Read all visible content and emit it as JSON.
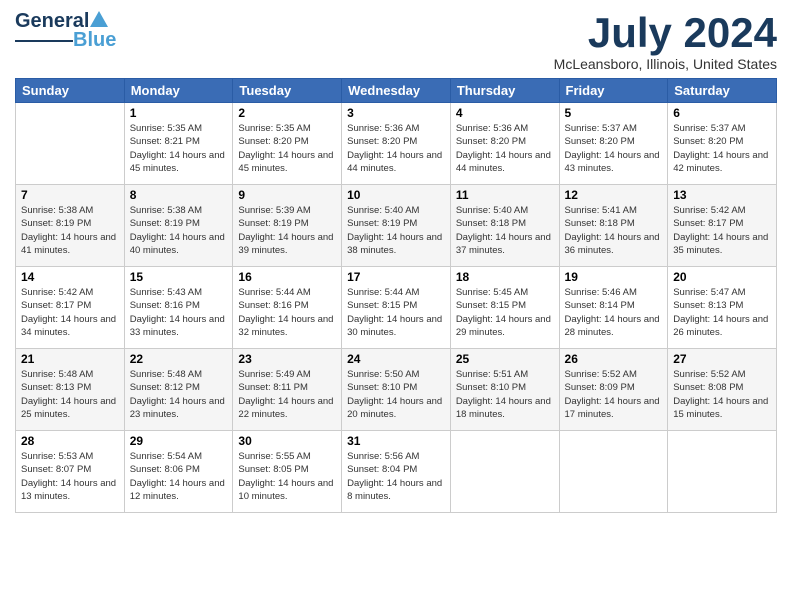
{
  "header": {
    "logo_general": "General",
    "logo_blue": "Blue",
    "month_title": "July 2024",
    "location": "McLeansboro, Illinois, United States"
  },
  "weekdays": [
    "Sunday",
    "Monday",
    "Tuesday",
    "Wednesday",
    "Thursday",
    "Friday",
    "Saturday"
  ],
  "weeks": [
    [
      {
        "day": "",
        "sunrise": "",
        "sunset": "",
        "daylight": ""
      },
      {
        "day": "1",
        "sunrise": "Sunrise: 5:35 AM",
        "sunset": "Sunset: 8:21 PM",
        "daylight": "Daylight: 14 hours and 45 minutes."
      },
      {
        "day": "2",
        "sunrise": "Sunrise: 5:35 AM",
        "sunset": "Sunset: 8:20 PM",
        "daylight": "Daylight: 14 hours and 45 minutes."
      },
      {
        "day": "3",
        "sunrise": "Sunrise: 5:36 AM",
        "sunset": "Sunset: 8:20 PM",
        "daylight": "Daylight: 14 hours and 44 minutes."
      },
      {
        "day": "4",
        "sunrise": "Sunrise: 5:36 AM",
        "sunset": "Sunset: 8:20 PM",
        "daylight": "Daylight: 14 hours and 44 minutes."
      },
      {
        "day": "5",
        "sunrise": "Sunrise: 5:37 AM",
        "sunset": "Sunset: 8:20 PM",
        "daylight": "Daylight: 14 hours and 43 minutes."
      },
      {
        "day": "6",
        "sunrise": "Sunrise: 5:37 AM",
        "sunset": "Sunset: 8:20 PM",
        "daylight": "Daylight: 14 hours and 42 minutes."
      }
    ],
    [
      {
        "day": "7",
        "sunrise": "Sunrise: 5:38 AM",
        "sunset": "Sunset: 8:19 PM",
        "daylight": "Daylight: 14 hours and 41 minutes."
      },
      {
        "day": "8",
        "sunrise": "Sunrise: 5:38 AM",
        "sunset": "Sunset: 8:19 PM",
        "daylight": "Daylight: 14 hours and 40 minutes."
      },
      {
        "day": "9",
        "sunrise": "Sunrise: 5:39 AM",
        "sunset": "Sunset: 8:19 PM",
        "daylight": "Daylight: 14 hours and 39 minutes."
      },
      {
        "day": "10",
        "sunrise": "Sunrise: 5:40 AM",
        "sunset": "Sunset: 8:19 PM",
        "daylight": "Daylight: 14 hours and 38 minutes."
      },
      {
        "day": "11",
        "sunrise": "Sunrise: 5:40 AM",
        "sunset": "Sunset: 8:18 PM",
        "daylight": "Daylight: 14 hours and 37 minutes."
      },
      {
        "day": "12",
        "sunrise": "Sunrise: 5:41 AM",
        "sunset": "Sunset: 8:18 PM",
        "daylight": "Daylight: 14 hours and 36 minutes."
      },
      {
        "day": "13",
        "sunrise": "Sunrise: 5:42 AM",
        "sunset": "Sunset: 8:17 PM",
        "daylight": "Daylight: 14 hours and 35 minutes."
      }
    ],
    [
      {
        "day": "14",
        "sunrise": "Sunrise: 5:42 AM",
        "sunset": "Sunset: 8:17 PM",
        "daylight": "Daylight: 14 hours and 34 minutes."
      },
      {
        "day": "15",
        "sunrise": "Sunrise: 5:43 AM",
        "sunset": "Sunset: 8:16 PM",
        "daylight": "Daylight: 14 hours and 33 minutes."
      },
      {
        "day": "16",
        "sunrise": "Sunrise: 5:44 AM",
        "sunset": "Sunset: 8:16 PM",
        "daylight": "Daylight: 14 hours and 32 minutes."
      },
      {
        "day": "17",
        "sunrise": "Sunrise: 5:44 AM",
        "sunset": "Sunset: 8:15 PM",
        "daylight": "Daylight: 14 hours and 30 minutes."
      },
      {
        "day": "18",
        "sunrise": "Sunrise: 5:45 AM",
        "sunset": "Sunset: 8:15 PM",
        "daylight": "Daylight: 14 hours and 29 minutes."
      },
      {
        "day": "19",
        "sunrise": "Sunrise: 5:46 AM",
        "sunset": "Sunset: 8:14 PM",
        "daylight": "Daylight: 14 hours and 28 minutes."
      },
      {
        "day": "20",
        "sunrise": "Sunrise: 5:47 AM",
        "sunset": "Sunset: 8:13 PM",
        "daylight": "Daylight: 14 hours and 26 minutes."
      }
    ],
    [
      {
        "day": "21",
        "sunrise": "Sunrise: 5:48 AM",
        "sunset": "Sunset: 8:13 PM",
        "daylight": "Daylight: 14 hours and 25 minutes."
      },
      {
        "day": "22",
        "sunrise": "Sunrise: 5:48 AM",
        "sunset": "Sunset: 8:12 PM",
        "daylight": "Daylight: 14 hours and 23 minutes."
      },
      {
        "day": "23",
        "sunrise": "Sunrise: 5:49 AM",
        "sunset": "Sunset: 8:11 PM",
        "daylight": "Daylight: 14 hours and 22 minutes."
      },
      {
        "day": "24",
        "sunrise": "Sunrise: 5:50 AM",
        "sunset": "Sunset: 8:10 PM",
        "daylight": "Daylight: 14 hours and 20 minutes."
      },
      {
        "day": "25",
        "sunrise": "Sunrise: 5:51 AM",
        "sunset": "Sunset: 8:10 PM",
        "daylight": "Daylight: 14 hours and 18 minutes."
      },
      {
        "day": "26",
        "sunrise": "Sunrise: 5:52 AM",
        "sunset": "Sunset: 8:09 PM",
        "daylight": "Daylight: 14 hours and 17 minutes."
      },
      {
        "day": "27",
        "sunrise": "Sunrise: 5:52 AM",
        "sunset": "Sunset: 8:08 PM",
        "daylight": "Daylight: 14 hours and 15 minutes."
      }
    ],
    [
      {
        "day": "28",
        "sunrise": "Sunrise: 5:53 AM",
        "sunset": "Sunset: 8:07 PM",
        "daylight": "Daylight: 14 hours and 13 minutes."
      },
      {
        "day": "29",
        "sunrise": "Sunrise: 5:54 AM",
        "sunset": "Sunset: 8:06 PM",
        "daylight": "Daylight: 14 hours and 12 minutes."
      },
      {
        "day": "30",
        "sunrise": "Sunrise: 5:55 AM",
        "sunset": "Sunset: 8:05 PM",
        "daylight": "Daylight: 14 hours and 10 minutes."
      },
      {
        "day": "31",
        "sunrise": "Sunrise: 5:56 AM",
        "sunset": "Sunset: 8:04 PM",
        "daylight": "Daylight: 14 hours and 8 minutes."
      },
      {
        "day": "",
        "sunrise": "",
        "sunset": "",
        "daylight": ""
      },
      {
        "day": "",
        "sunrise": "",
        "sunset": "",
        "daylight": ""
      },
      {
        "day": "",
        "sunrise": "",
        "sunset": "",
        "daylight": ""
      }
    ]
  ]
}
